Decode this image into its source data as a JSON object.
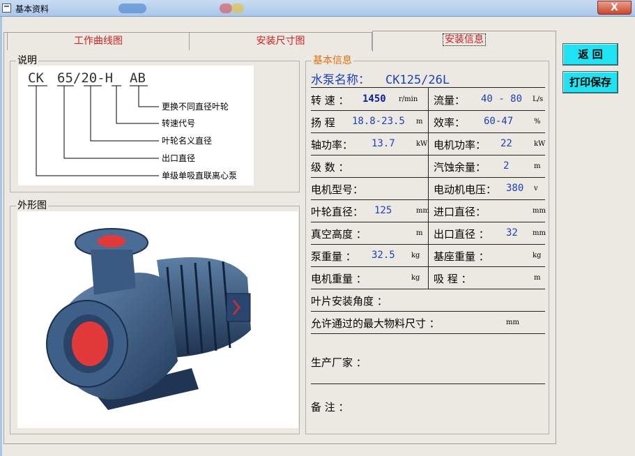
{
  "window": {
    "title": "基本资料",
    "close_label": "X"
  },
  "tabs": [
    {
      "label": "工作曲线图",
      "active": false
    },
    {
      "label": "安装尺寸图",
      "active": false
    },
    {
      "label": "安装信息",
      "active": true
    }
  ],
  "explanation": {
    "group_label": "说明",
    "code_parts": [
      "CK",
      "65/20-H",
      "AB"
    ],
    "descriptions": [
      "更换不同直径叶轮",
      "转速代号",
      "叶轮名义直径",
      "出口直径",
      "单级单吸直联离心泵"
    ]
  },
  "outline": {
    "group_label": "外形图"
  },
  "basic_info": {
    "group_label": "基本信息",
    "pump_name_label": "水泵名称：",
    "pump_name_value": "CK125/26L",
    "rows": [
      {
        "l_label": "转 速 ：",
        "l_value": "1450",
        "l_unit": "r/min",
        "r_label": "流量：",
        "r_value": "40 - 80",
        "r_unit": "L/s"
      },
      {
        "l_label": "扬 程",
        "l_value": "18.8-23.5",
        "l_unit": "m",
        "r_label": "效率：",
        "r_value": "60-47",
        "r_unit": "%"
      },
      {
        "l_label": "轴功率：",
        "l_value": "13.7",
        "l_unit": "kW",
        "r_label": "电机功率：",
        "r_value": "22",
        "r_unit": "kW"
      },
      {
        "l_label": "级 数 ：",
        "l_value": "",
        "l_unit": "",
        "r_label": "汽蚀余量：",
        "r_value": "2",
        "r_unit": "m"
      },
      {
        "l_label": "电机型号：",
        "l_value": "",
        "l_unit": "",
        "r_label": "电动机电压：",
        "r_value": "380",
        "r_unit": "v"
      },
      {
        "l_label": "叶轮直径：",
        "l_value": "125",
        "l_unit": "mm",
        "r_label": "进口直径：",
        "r_value": "",
        "r_unit": "mm"
      },
      {
        "l_label": "真空高度 ：",
        "l_value": "",
        "l_unit": "m",
        "r_label": "出口直径 ：",
        "r_value": "32",
        "r_unit": "mm"
      },
      {
        "l_label": "泵重量 ：",
        "l_value": "32.5",
        "l_unit": "kg",
        "r_label": "基座重量 ：",
        "r_value": "",
        "r_unit": "kg"
      },
      {
        "l_label": "电机重量 ：",
        "l_value": "",
        "l_unit": "kg",
        "r_label": "吸 程 ：",
        "r_value": "",
        "r_unit": "m"
      }
    ],
    "blade_angle_label": "叶片安装角度 ：",
    "max_size_label": "允许通过的最大物料尺寸 ：",
    "max_size_unit": "mm",
    "manufacturer_label": "生产厂家 ：",
    "remark_label": "备 注 ："
  },
  "buttons": {
    "back": "返 回",
    "print_save": "打印保存"
  },
  "colors": {
    "accent_blue": "#1c3fbf",
    "tab_red": "#d02020",
    "button_cyan": "#1fe3f2",
    "group_orange": "#e07010"
  }
}
